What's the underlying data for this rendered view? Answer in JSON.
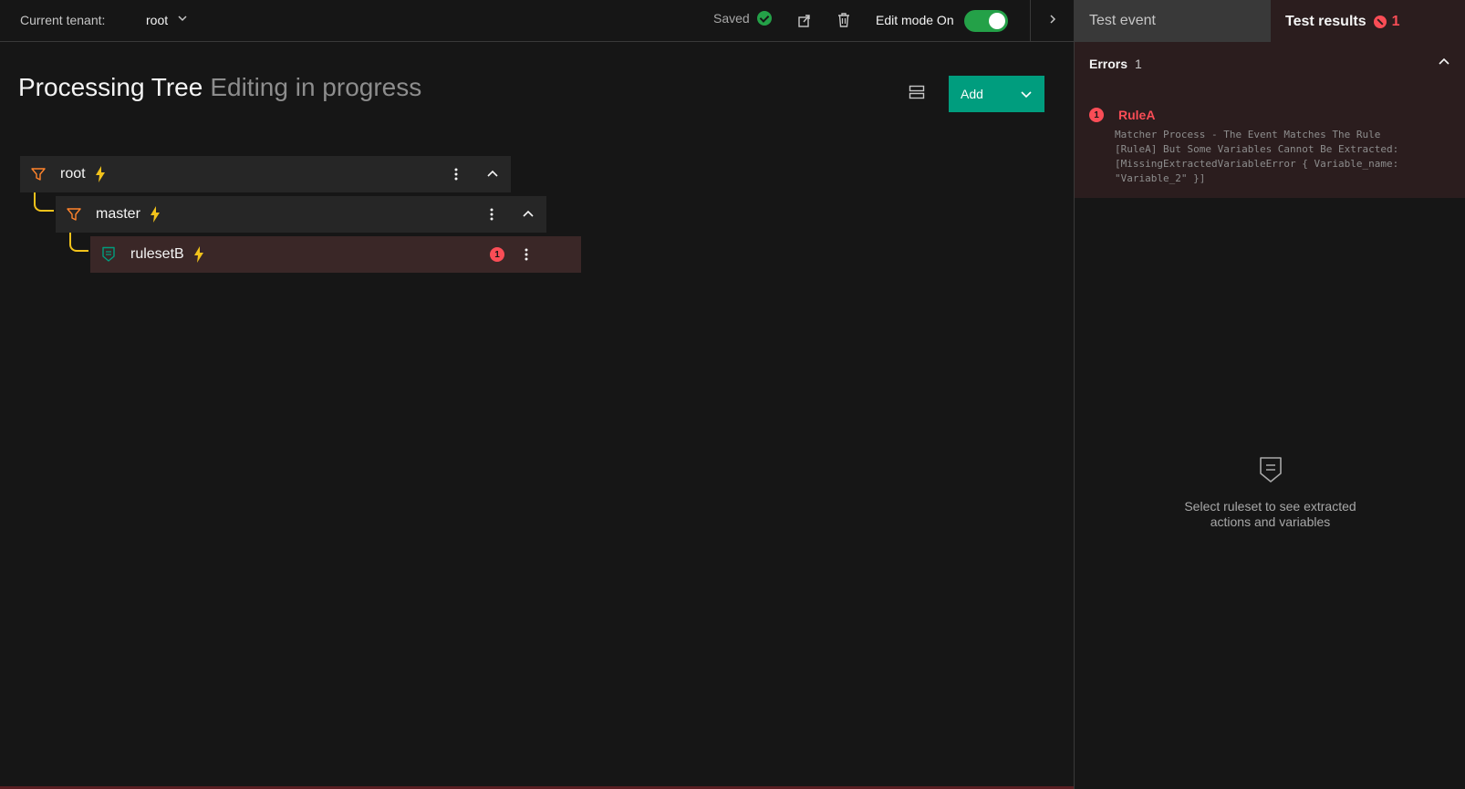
{
  "topbar": {
    "tenant_label": "Current tenant:",
    "tenant_value": "root",
    "saved_label": "Saved",
    "edit_mode_label": "Edit mode On"
  },
  "main": {
    "title": "Processing Tree",
    "subtitle": "Editing in progress",
    "add_label": "Add"
  },
  "tree": {
    "root": {
      "name": "root"
    },
    "master": {
      "name": "master"
    },
    "ruleset": {
      "name": "rulesetB",
      "error_count": "1"
    }
  },
  "right_panel": {
    "tab_event": "Test event",
    "tab_results": "Test results",
    "tab_results_count": "1",
    "errors": {
      "title": "Errors",
      "count": "1",
      "items": [
        {
          "index": "1",
          "rule": "RuleA",
          "message": "Matcher Process - The Event Matches The Rule\n[RuleA] But Some Variables Cannot Be Extracted:\n[MissingExtractedVariableError { Variable_name:\n\"Variable_2\" }]"
        }
      ]
    },
    "empty_state": {
      "line1": "Select ruleset to see extracted",
      "line2": "actions and variables"
    }
  },
  "colors": {
    "accent": "#009d7e",
    "success": "#24a148",
    "error": "#fa4d56",
    "bolt": "#f1c21b",
    "filter_icon": "#ff832b",
    "ruleset_icon": "#009d7e"
  }
}
